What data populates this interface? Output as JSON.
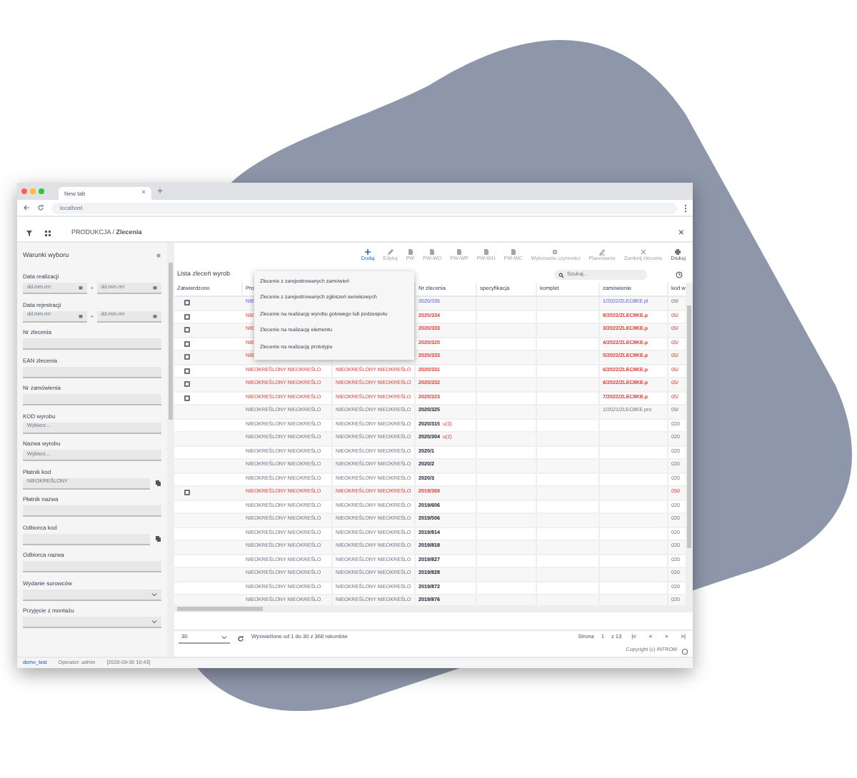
{
  "browser": {
    "tab": {
      "title": "New tab",
      "close": "×"
    },
    "new_tab": "+",
    "address": "localhost"
  },
  "app_header": {
    "breadcrumb": "PRODUKCJA / **Zlecenia**",
    "close": "×"
  },
  "sidebar": {
    "title": "Warunki wyboru",
    "fields": [
      {
        "kind": "date-range",
        "label": "Data realizacji",
        "from": "dd.mm.rrrr",
        "to": "dd.mm.rrrr",
        "sep": "÷"
      },
      {
        "kind": "date-range",
        "label": "Data rejestracji",
        "from": "dd.mm.rrrr",
        "to": "dd.mm.rrrr",
        "sep": "÷"
      },
      {
        "kind": "text",
        "label": "Nr zlecenia"
      },
      {
        "kind": "text",
        "label": "EAN zlecenia"
      },
      {
        "kind": "text",
        "label": "Nr zamówienia"
      },
      {
        "kind": "text",
        "label": "KOD wyrobu",
        "placeholder": "Wybierz..."
      },
      {
        "kind": "text",
        "label": "Nazwa wyrobu",
        "placeholder": "Wybierz..."
      },
      {
        "kind": "lookup",
        "label": "Płatnik kod",
        "value": "NIEOKREŚLONY"
      },
      {
        "kind": "text",
        "label": "Płatnik nazwa"
      },
      {
        "kind": "lookup",
        "label": "Odbiorca kod"
      },
      {
        "kind": "text",
        "label": "Odbiorca nazwa"
      },
      {
        "kind": "select",
        "label": "Wydanie surowców"
      },
      {
        "kind": "select",
        "label": "Przyjęcie z montażu"
      }
    ]
  },
  "toolbar": [
    {
      "label": "Dodaj",
      "disabled": false
    },
    {
      "label": "Edytuj",
      "disabled": true
    },
    {
      "label": "PW",
      "disabled": true
    },
    {
      "label": "PW-WG",
      "disabled": true
    },
    {
      "label": "PW-WP",
      "disabled": true
    },
    {
      "label": "PW-WU",
      "disabled": true
    },
    {
      "label": "PW-WC",
      "disabled": true
    },
    {
      "label": "Wykonanie czynności",
      "disabled": true
    },
    {
      "label": "Planowanie",
      "disabled": true
    },
    {
      "label": "Zamknij zlecenie",
      "disabled": true
    },
    {
      "label": "Drukuj",
      "disabled": false
    }
  ],
  "list": {
    "title": "Lista zleceń wyrob",
    "search": {
      "placeholder": "Szukaj..."
    }
  },
  "add_menu": [
    "Zlecenie z zarejestrowanych zamówień",
    "Zlecenie z zarejestrowanych zgłoszeń serwisowych",
    "Zlecenie na realizację wyrobu gotowego lub podzespołu",
    "Zlecenie na realizację elementu",
    "Zlecenie na realizację prototypu"
  ],
  "table": {
    "columns": [
      "Zatwierdzono",
      "Pro",
      "",
      "Nr zlecenia",
      "specyfikacja",
      "komplet",
      "zamówienie",
      "kod w"
    ],
    "rows": [
      {
        "kind": "new",
        "checked": false,
        "c1": "NIE",
        "nr": "2020/335",
        "zam": "1/2022/ZLEC8KE.pl",
        "kod": "09/"
      },
      {
        "kind": "late",
        "checked": false,
        "c1": "NIE",
        "nr": "2020/334",
        "zam": "8/2022/ZLEC8KE.p",
        "kod": "05/"
      },
      {
        "kind": "late",
        "checked": false,
        "c1": "NIE",
        "nr": "2020/333",
        "zam": "3/2022/ZLEC8KE.p",
        "kod": "05/"
      },
      {
        "kind": "late",
        "checked": false,
        "c1": "NIE",
        "nr": "2020/320",
        "zam": "4/2022/ZLEC8KE.p",
        "kod": "05/"
      },
      {
        "kind": "late",
        "checked": false,
        "c1": "NIE",
        "nr": "2020/333",
        "zam": "5/2022/ZLEC8KE.p",
        "kod": "05/"
      },
      {
        "kind": "late",
        "checked": false,
        "c1": "NIEOKREŚLONY NIEOKREŚLO",
        "c2": "NIEOKREŚLONY NIEOKREŚLO",
        "nr": "2020/331",
        "zam": "6/2022/ZLEC8KE.p",
        "kod": "05/"
      },
      {
        "kind": "late",
        "checked": false,
        "c1": "NIEOKREŚLONY NIEOKREŚLO",
        "c2": "NIEOKREŚLONY NIEOKREŚLO",
        "nr": "2020/332",
        "zam": "6/2022/ZLEC8KE.p",
        "kod": "05/"
      },
      {
        "kind": "late",
        "checked": false,
        "c1": "NIEOKREŚLONY NIEOKREŚLO",
        "c2": "NIEOKREŚLONY NIEOKREŚLO",
        "nr": "2020/323",
        "zam": "7/2022/ZLEC8KE.p",
        "kod": "05/"
      },
      {
        "kind": "normal",
        "c1": "NIEOKREŚLONY NIEOKREŚLO",
        "c2": "NIEOKREŚLONY NIEOKREŚLO",
        "nr": "2020/325",
        "zam": "1/2021/ZLEC8KE.pro",
        "kod": "09/"
      },
      {
        "kind": "normal",
        "c1": "NIEOKREŚLONY NIEOKREŚLO",
        "c2": "NIEOKREŚLONY NIEOKREŚLO",
        "nr": "2020/315",
        "flag": "u(3)",
        "kod": "020"
      },
      {
        "kind": "normal",
        "c1": "NIEOKREŚLONY NIEOKREŚLO",
        "c2": "NIEOKREŚLONY NIEOKREŚLO",
        "nr": "2020/304",
        "flag": "u(2)",
        "kod": "020"
      },
      {
        "kind": "normal",
        "c1": "NIEOKREŚLONY NIEOKREŚLO",
        "c2": "NIEOKREŚLONY NIEOKREŚLO",
        "nr": "2020/1",
        "kod": "020"
      },
      {
        "kind": "normal",
        "c1": "NIEOKREŚLONY NIEOKREŚLO",
        "c2": "NIEOKREŚLONY NIEOKREŚLO",
        "nr": "2020/2",
        "kod": "020"
      },
      {
        "kind": "normal",
        "c1": "NIEOKREŚLONY NIEOKREŚLO",
        "c2": "NIEOKREŚLONY NIEOKREŚLO",
        "nr": "2020/3",
        "kod": "020"
      },
      {
        "kind": "late",
        "checked": false,
        "c1": "NIEOKREŚLONY NIEOKREŚLO",
        "c2": "NIEOKREŚLONY NIEOKREŚLO",
        "nr": "2019/368",
        "kod": "050"
      },
      {
        "kind": "normal",
        "c1": "NIEOKREŚLONY NIEOKREŚLO",
        "c2": "NIEOKREŚLONY NIEOKREŚLO",
        "nr": "2019/606",
        "kod": "020"
      },
      {
        "kind": "normal",
        "c1": "NIEOKREŚLONY NIEOKREŚLO",
        "c2": "NIEOKREŚLONY NIEOKREŚLO",
        "nr": "2019/506",
        "kod": "020"
      },
      {
        "kind": "normal",
        "c1": "NIEOKREŚLONY NIEOKREŚLO",
        "c2": "NIEOKREŚLONY NIEOKREŚLO",
        "nr": "2019/814",
        "kod": "020"
      },
      {
        "kind": "normal",
        "c1": "NIEOKREŚLONY NIEOKREŚLO",
        "c2": "NIEOKREŚLONY NIEOKREŚLO",
        "nr": "2019/818",
        "kod": "020"
      },
      {
        "kind": "normal",
        "c1": "NIEOKREŚLONY NIEOKREŚLO",
        "c2": "NIEOKREŚLONY NIEOKREŚLO",
        "nr": "2019/827",
        "kod": "020"
      },
      {
        "kind": "normal",
        "c1": "NIEOKREŚLONY NIEOKREŚLO",
        "c2": "NIEOKREŚLONY NIEOKREŚLO",
        "nr": "2019/828",
        "kod": "020"
      },
      {
        "kind": "normal",
        "c1": "NIEOKREŚLONY NIEOKREŚLO",
        "c2": "NIEOKREŚLONY NIEOKREŚLO",
        "nr": "2019/872",
        "kod": "020"
      },
      {
        "kind": "normal",
        "c1": "NIEOKREŚLONY NIEOKREŚLO",
        "c2": "NIEOKREŚLONY NIEOKREŚLO",
        "nr": "2019/876",
        "kod": "020"
      }
    ]
  },
  "footer": {
    "page_size": "30",
    "summary": "Wyświetlone od 1 do 30 z 368 rekordów",
    "page_label": "Strona",
    "page": "1",
    "of": "z 13",
    "first": "|<",
    "prev": "<",
    "next": ">",
    "last": ">|",
    "copyright": "Copyright (c) INTROM"
  },
  "status_bar": {
    "user": "demo_test",
    "operator": "Operator: admin",
    "time": "[2020-09-30 10:43]"
  }
}
